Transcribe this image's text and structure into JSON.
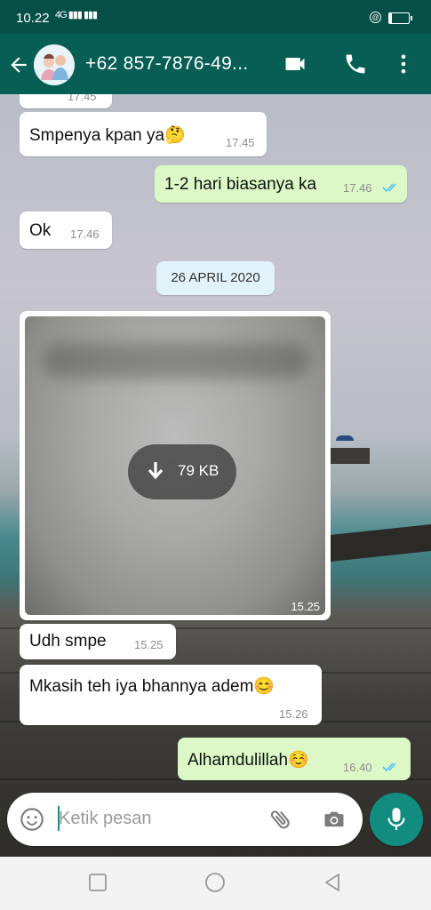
{
  "status_bar": {
    "time": "10.22",
    "signal_text": "ⁿ⁴ᴳ.ııl .ıl",
    "battery_icon": "battery-icon",
    "dnd_icon": "@"
  },
  "header": {
    "contact_name": "+62 857-7876-49...",
    "icons": [
      "back-arrow-icon",
      "video-call-icon",
      "phone-icon",
      "more-vert-icon"
    ]
  },
  "chat": {
    "partial_top_time": "17.45",
    "messages": [
      {
        "direction": "in",
        "text": "Smpenya kpan ya🤔",
        "time": "17.45"
      },
      {
        "direction": "out",
        "text": "1-2 hari biasanya ka",
        "time": "17.46",
        "status": "read"
      },
      {
        "direction": "in",
        "text": "Ok",
        "time": "17.46"
      }
    ],
    "date_chip": "26 APRIL 2020",
    "image_message": {
      "direction": "in",
      "download_size": "79 KB",
      "time": "15.25"
    },
    "messages_after": [
      {
        "direction": "in",
        "text": "Udh smpe",
        "time": "15.25"
      },
      {
        "direction": "in",
        "text": "Mkasih teh iya bhannya adem😊",
        "time": "15.26"
      },
      {
        "direction": "out",
        "text": "Alhamdulillah☺️",
        "time": "16.40",
        "status": "read"
      }
    ]
  },
  "input": {
    "placeholder": "Ketik pesan",
    "icons": [
      "emoji-icon",
      "attach-icon",
      "camera-icon",
      "mic-icon"
    ]
  },
  "colors": {
    "header": "#075e54",
    "status_bar": "#064f47",
    "outgoing_bubble": "#dcf8c6",
    "incoming_bubble": "#ffffff",
    "read_ticks": "#4fc3f7",
    "mic_button": "#128c7e"
  },
  "nav_bar": {
    "icons": [
      "recent-apps-icon",
      "home-icon",
      "back-icon"
    ]
  }
}
